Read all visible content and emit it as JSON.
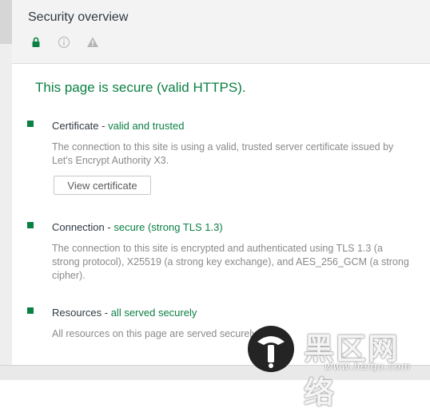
{
  "header": {
    "title": "Security overview",
    "icons": [
      "lock-icon",
      "info-icon",
      "warning-icon"
    ]
  },
  "summary": "This page is secure (valid HTTPS).",
  "sections": [
    {
      "label": "Certificate",
      "separator": " - ",
      "state": "valid and trusted",
      "description": "The connection to this site is using a valid, trusted server certificate issued by Let's Encrypt Authority X3.",
      "button": "View certificate"
    },
    {
      "label": "Connection",
      "separator": " - ",
      "state": "secure (strong TLS 1.3)",
      "description": "The connection to this site is encrypted and authenticated using TLS 1.3 (a strong protocol), X25519 (a strong key exchange), and AES_256_GCM (a strong cipher)."
    },
    {
      "label": "Resources",
      "separator": " - ",
      "state": "all served securely",
      "description": "All resources on this page are served securely."
    }
  ],
  "watermark": {
    "text": "黑区网络",
    "url": "www.heiqu.com"
  },
  "colors": {
    "secure_green": "#0b8043",
    "muted_text": "#8a8a8a",
    "header_bg": "#f3f3f3"
  }
}
